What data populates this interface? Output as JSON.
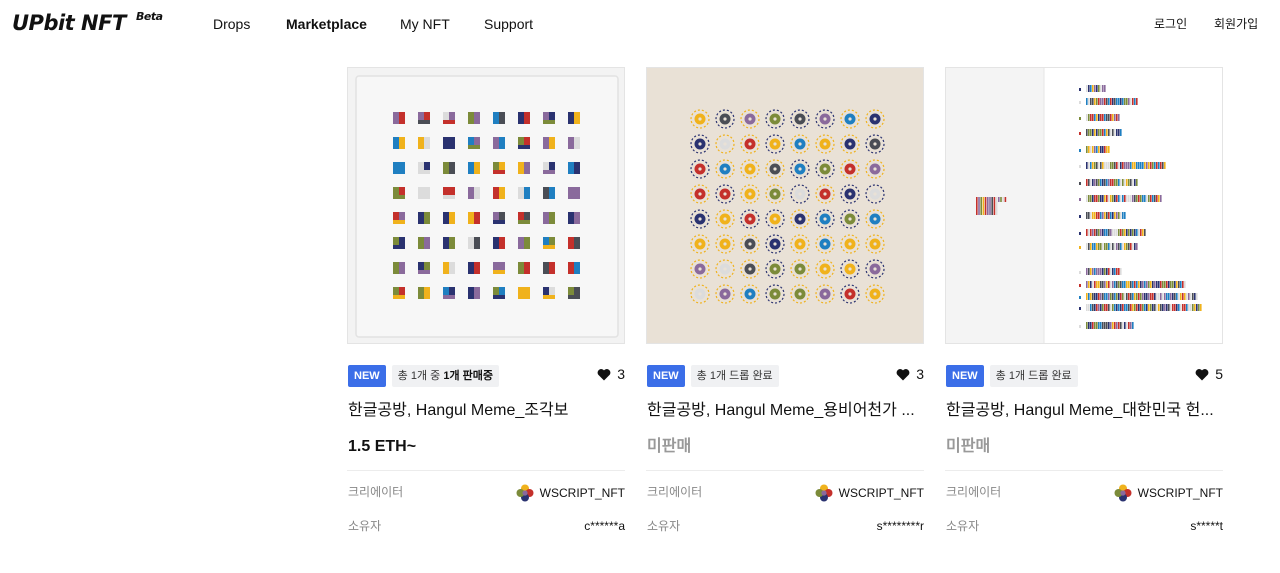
{
  "header": {
    "logo": "UPbit NFT",
    "logo_beta": "Beta",
    "nav": [
      {
        "label": "Drops",
        "active": false
      },
      {
        "label": "Marketplace",
        "active": true
      },
      {
        "label": "My NFT",
        "active": false
      },
      {
        "label": "Support",
        "active": false
      }
    ],
    "login": "로그인",
    "signup": "회원가입"
  },
  "cards": [
    {
      "new_tag": "NEW",
      "status_prefix": "총 1개 중 ",
      "status_bold": "1개 판매중",
      "likes": "3",
      "title": "한글공방, Hangul Meme_조각보",
      "price": "1.5 ETH~",
      "price_state": "selling",
      "creator_label": "크리에이터",
      "creator_name": "WSCRIPT_NFT",
      "owner_label": "소유자",
      "owner_name": "c******a"
    },
    {
      "new_tag": "NEW",
      "status_prefix": "총 1개 드롭 완료",
      "status_bold": "",
      "likes": "3",
      "title": "한글공방, Hangul Meme_용비어천가 ...",
      "price": "미판매",
      "price_state": "unsold",
      "creator_label": "크리에이터",
      "creator_name": "WSCRIPT_NFT",
      "owner_label": "소유자",
      "owner_name": "s********r"
    },
    {
      "new_tag": "NEW",
      "status_prefix": "총 1개 드롭 완료",
      "status_bold": "",
      "likes": "5",
      "title": "한글공방, Hangul Meme_대한민국 헌...",
      "price": "미판매",
      "price_state": "unsold",
      "creator_label": "크리에이터",
      "creator_name": "WSCRIPT_NFT",
      "owner_label": "소유자",
      "owner_name": "s*****t"
    }
  ],
  "colors": {
    "accent": "#3b6ee8",
    "palette": [
      "#c4302b",
      "#1f7fc1",
      "#f0b21c",
      "#8a6a9c",
      "#4a4d55",
      "#7c8b3a",
      "#dcdcdc",
      "#2a3270"
    ]
  }
}
